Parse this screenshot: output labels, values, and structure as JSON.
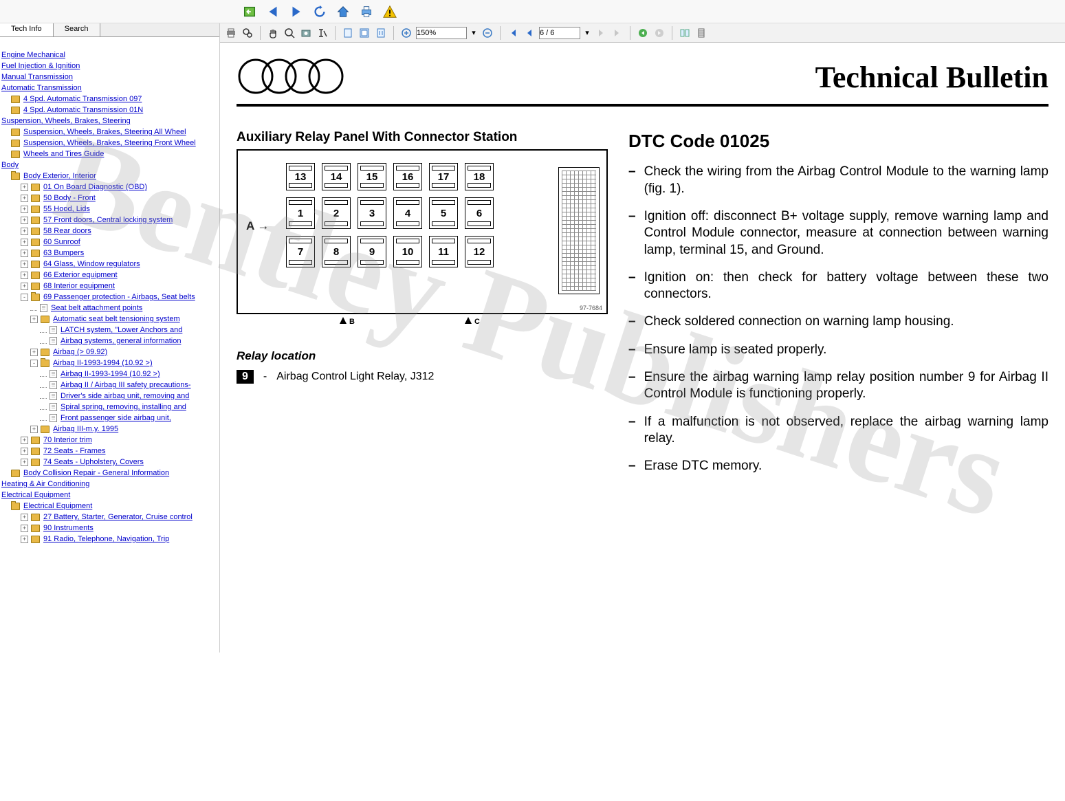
{
  "watermark": "Bentley Publishers",
  "tabs": {
    "tech_info": "Tech Info",
    "search": "Search"
  },
  "toolbar_top": {
    "icons": [
      "back-window",
      "prev",
      "next",
      "refresh",
      "home",
      "print",
      "warning"
    ]
  },
  "pdf_toolbar": {
    "zoom_value": "150%",
    "page_value": "6 / 6"
  },
  "tree": {
    "items": [
      {
        "lvl": 0,
        "type": "link",
        "label": "Engine Mechanical"
      },
      {
        "lvl": 0,
        "type": "link",
        "label": "Fuel Injection & Ignition"
      },
      {
        "lvl": 0,
        "type": "link",
        "label": "Manual Transmission"
      },
      {
        "lvl": 0,
        "type": "link",
        "label": "Automatic Transmission"
      },
      {
        "lvl": 1,
        "type": "folder",
        "label": "4 Spd. Automatic Transmission 097"
      },
      {
        "lvl": 1,
        "type": "folder",
        "label": "4 Spd. Automatic Transmission 01N"
      },
      {
        "lvl": 0,
        "type": "link",
        "label": "Suspension, Wheels, Brakes, Steering"
      },
      {
        "lvl": 1,
        "type": "folder",
        "label": "Suspension, Wheels, Brakes, Steering All Wheel"
      },
      {
        "lvl": 1,
        "type": "folder",
        "label": "Suspension, Wheels, Brakes, Steering Front Wheel"
      },
      {
        "lvl": 1,
        "type": "folder",
        "label": "Wheels and Tires Guide"
      },
      {
        "lvl": 0,
        "type": "link",
        "label": "Body"
      },
      {
        "lvl": 1,
        "type": "folder-open",
        "label": "Body Exterior, Interior"
      },
      {
        "lvl": 2,
        "type": "folder",
        "exp": "+",
        "label": "01 On Board Diagnostic (OBD)"
      },
      {
        "lvl": 2,
        "type": "folder",
        "exp": "+",
        "label": "50 Body - Front"
      },
      {
        "lvl": 2,
        "type": "folder",
        "exp": "+",
        "label": "55 Hood, Lids"
      },
      {
        "lvl": 2,
        "type": "folder",
        "exp": "+",
        "label": "57 Front doors, Central locking system"
      },
      {
        "lvl": 2,
        "type": "folder",
        "exp": "+",
        "label": "58 Rear doors"
      },
      {
        "lvl": 2,
        "type": "folder",
        "exp": "+",
        "label": "60 Sunroof"
      },
      {
        "lvl": 2,
        "type": "folder",
        "exp": "+",
        "label": "63 Bumpers"
      },
      {
        "lvl": 2,
        "type": "folder",
        "exp": "+",
        "label": "64 Glass, Window regulators"
      },
      {
        "lvl": 2,
        "type": "folder",
        "exp": "+",
        "label": "66 Exterior equipment"
      },
      {
        "lvl": 2,
        "type": "folder",
        "exp": "+",
        "label": "68 Interior equipment"
      },
      {
        "lvl": 2,
        "type": "folder-open",
        "exp": "-",
        "label": "69 Passenger protection - Airbags, Seat belts"
      },
      {
        "lvl": 3,
        "type": "page",
        "label": "Seat belt attachment points"
      },
      {
        "lvl": 3,
        "type": "folder",
        "exp": "+",
        "label": "Automatic seat belt tensioning system"
      },
      {
        "lvl": 4,
        "type": "page",
        "label": "LATCH system, \"Lower Anchors and"
      },
      {
        "lvl": 4,
        "type": "page",
        "label": "Airbag systems, general information"
      },
      {
        "lvl": 3,
        "type": "folder",
        "exp": "+",
        "label": "Airbag (> 09.92)"
      },
      {
        "lvl": 3,
        "type": "folder-open",
        "exp": "-",
        "label": "Airbag II-1993-1994 (10.92 >)"
      },
      {
        "lvl": 4,
        "type": "page",
        "label": "Airbag II-1993-1994 (10.92 >)"
      },
      {
        "lvl": 4,
        "type": "page",
        "label": "Airbag II / Airbag III safety precautions-"
      },
      {
        "lvl": 4,
        "type": "page",
        "label": "Driver's side airbag unit, removing and"
      },
      {
        "lvl": 4,
        "type": "page",
        "label": "Spiral spring, removing, installing and"
      },
      {
        "lvl": 4,
        "type": "page",
        "label": "Front passenger side airbag unit,"
      },
      {
        "lvl": 3,
        "type": "folder",
        "exp": "+",
        "label": "Airbag III-m.y. 1995"
      },
      {
        "lvl": 2,
        "type": "folder",
        "exp": "+",
        "label": "70 Interior trim"
      },
      {
        "lvl": 2,
        "type": "folder",
        "exp": "+",
        "label": "72 Seats - Frames"
      },
      {
        "lvl": 2,
        "type": "folder",
        "exp": "+",
        "label": "74 Seats - Upholstery, Covers"
      },
      {
        "lvl": 1,
        "type": "folder",
        "label": "Body Collision Repair - General Information"
      },
      {
        "lvl": 0,
        "type": "link",
        "label": "Heating & Air Conditioning"
      },
      {
        "lvl": 0,
        "type": "link",
        "label": "Electrical Equipment"
      },
      {
        "lvl": 1,
        "type": "folder-open",
        "label": "Electrical Equipment"
      },
      {
        "lvl": 2,
        "type": "folder",
        "exp": "+",
        "label": "27 Battery, Starter, Generator, Cruise control"
      },
      {
        "lvl": 2,
        "type": "folder",
        "exp": "+",
        "label": "90 Instruments"
      },
      {
        "lvl": 2,
        "type": "folder",
        "exp": "+",
        "label": "91 Radio, Telephone, Navigation, Trip"
      }
    ]
  },
  "document": {
    "bulletin_title": "Technical Bulletin",
    "panel_title": "Auxiliary Relay Panel With Connector Station",
    "relay_row_top": [
      "13",
      "14",
      "15",
      "16",
      "17",
      "18"
    ],
    "relay_row_mid": [
      "1",
      "2",
      "3",
      "4",
      "5",
      "6"
    ],
    "relay_row_bot": [
      "7",
      "8",
      "9",
      "10",
      "11",
      "12"
    ],
    "marker_a": "A",
    "marker_b": "B",
    "marker_c": "C",
    "diag_number": "97-7684",
    "relay_location_title": "Relay location",
    "relay_badge": "9",
    "relay_badge_sep": "-",
    "relay_desc": "Airbag Control Light Relay, J312",
    "dtc_heading": "DTC Code 01025",
    "steps": [
      "Check the wiring from the Airbag Control Module to the warning lamp (fig. 1).",
      "Ignition off: disconnect B+ voltage supply, remove warning lamp and Control Module connector, measure at connection between warning lamp, terminal 15, and Ground.",
      "Ignition on: then check for battery voltage between these two connectors.",
      "Check soldered connection on warning lamp housing.",
      "Ensure lamp is seated properly.",
      "Ensure the airbag warning lamp relay position number 9 for Airbag II Control Module is functioning properly.",
      "If a malfunction is not observed, replace the airbag warning lamp relay.",
      "Erase DTC memory."
    ]
  }
}
